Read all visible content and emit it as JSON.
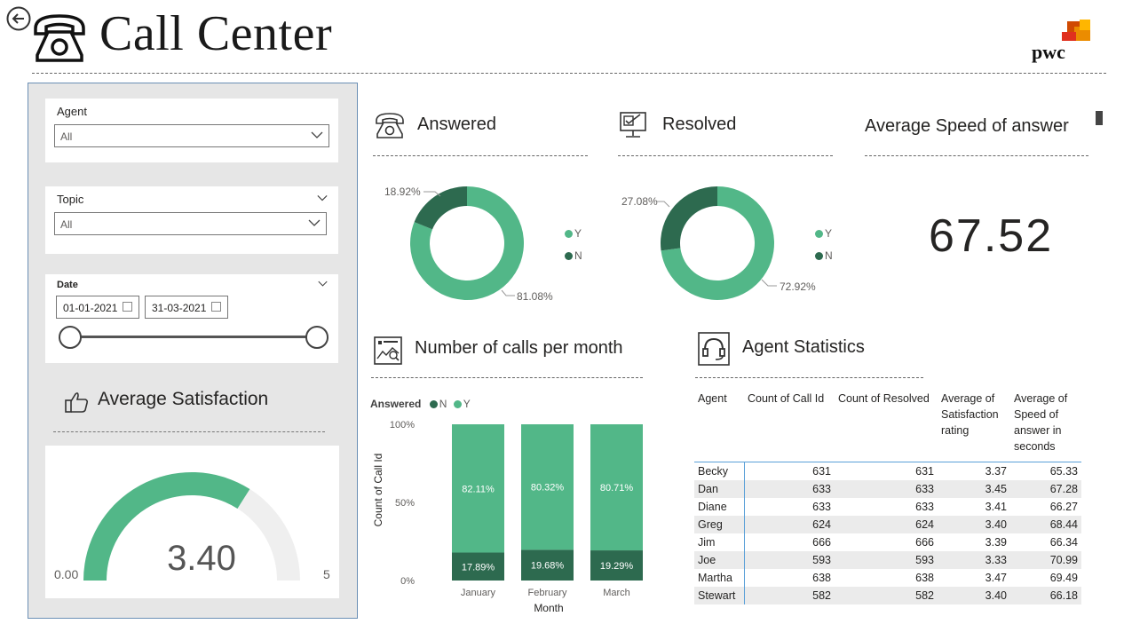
{
  "header": {
    "title": "Call Center",
    "brand": "pwc"
  },
  "filters": {
    "agent": {
      "label": "Agent",
      "value": "All"
    },
    "topic": {
      "label": "Topic",
      "value": "All"
    },
    "date": {
      "label": "Date",
      "start": "01-01-2021",
      "end": "31-03-2021"
    }
  },
  "satisfaction": {
    "title": "Average Satisfaction",
    "value": "3.40",
    "min": "0.00",
    "max": "5",
    "fraction": 0.68
  },
  "answered": {
    "title": "Answered",
    "legend": [
      "Y",
      "N"
    ],
    "y_label": "81.08%",
    "n_label": "18.92%"
  },
  "resolved": {
    "title": "Resolved",
    "legend": [
      "Y",
      "N"
    ],
    "y_label": "72.92%",
    "n_label": "27.08%"
  },
  "speed": {
    "title": "Average Speed of answer",
    "value": "67.52"
  },
  "calls_chart": {
    "title": "Number of calls per month",
    "legend_title": "Answered",
    "legend": [
      "N",
      "Y"
    ],
    "y_axis_label": "Count of Call Id",
    "x_axis_label": "Month",
    "y_ticks": [
      "100%",
      "50%",
      "0%"
    ]
  },
  "agent_stats": {
    "title": "Agent Statistics",
    "columns": [
      "Agent",
      "Count of Call Id",
      "Count of Resolved",
      "Average of Satisfaction rating",
      "Average of Speed of answer in seconds"
    ],
    "rows": [
      [
        "Becky",
        "631",
        "631",
        "3.37",
        "65.33"
      ],
      [
        "Dan",
        "633",
        "633",
        "3.45",
        "67.28"
      ],
      [
        "Diane",
        "633",
        "633",
        "3.41",
        "66.27"
      ],
      [
        "Greg",
        "624",
        "624",
        "3.40",
        "68.44"
      ],
      [
        "Jim",
        "666",
        "666",
        "3.39",
        "66.34"
      ],
      [
        "Joe",
        "593",
        "593",
        "3.33",
        "70.99"
      ],
      [
        "Martha",
        "638",
        "638",
        "3.47",
        "69.49"
      ],
      [
        "Stewart",
        "582",
        "582",
        "3.40",
        "66.18"
      ]
    ]
  },
  "colors": {
    "accent_light": "#52b788",
    "accent_dark": "#2d6a4f",
    "gauge_track": "#efefef"
  },
  "chart_data": [
    {
      "type": "pie",
      "title": "Answered",
      "categories": [
        "Y",
        "N"
      ],
      "values": [
        81.08,
        18.92
      ]
    },
    {
      "type": "pie",
      "title": "Resolved",
      "categories": [
        "Y",
        "N"
      ],
      "values": [
        72.92,
        27.08
      ]
    },
    {
      "type": "bar",
      "title": "Number of calls per month",
      "categories": [
        "January",
        "February",
        "March"
      ],
      "series": [
        {
          "name": "N",
          "values": [
            17.89,
            19.68,
            19.29
          ],
          "labels": [
            "17.89%",
            "19.68%",
            "19.29%"
          ]
        },
        {
          "name": "Y",
          "values": [
            82.11,
            80.32,
            80.71
          ],
          "labels": [
            "82.11%",
            "80.32%",
            "80.71%"
          ]
        }
      ],
      "stacked": true,
      "xlabel": "Month",
      "ylabel": "Count of Call Id",
      "ylim": [
        0,
        100
      ]
    }
  ]
}
